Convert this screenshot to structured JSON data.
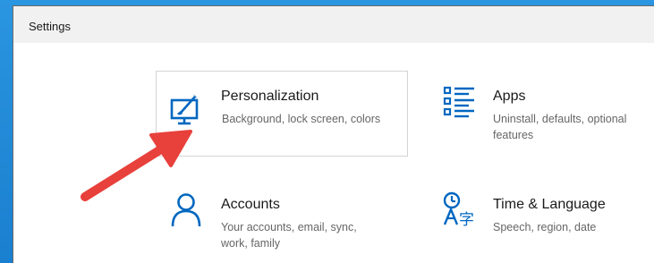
{
  "window": {
    "title": "Settings"
  },
  "tiles": [
    {
      "title": "Personalization",
      "description": "Background, lock screen, colors",
      "icon": "personalization-icon"
    },
    {
      "title": "Apps",
      "description": "Uninstall, defaults, optional features",
      "icon": "apps-list-icon"
    },
    {
      "title": "Accounts",
      "description": "Your accounts, email, sync, work, family",
      "icon": "person-icon"
    },
    {
      "title": "Time & Language",
      "description": "Speech, region, date",
      "icon": "time-language-icon"
    }
  ],
  "colors": {
    "accent": "#0067c0",
    "annotation_arrow": "#e8403b",
    "desktop": "#1f8ad8"
  }
}
